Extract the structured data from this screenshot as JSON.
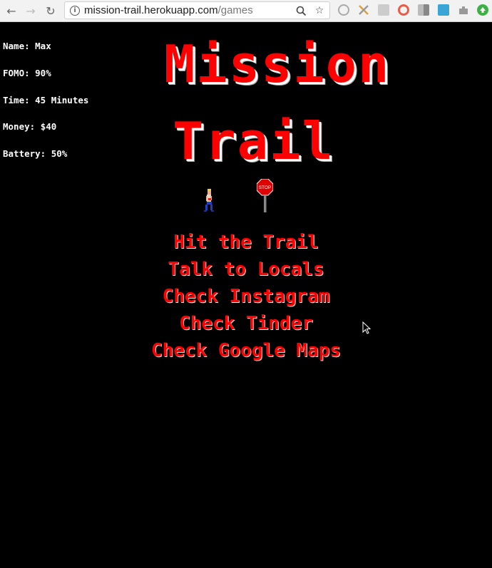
{
  "browser": {
    "url_host": "mission-trail.herokuapp.com",
    "url_path": "/games",
    "back_icon": "back-arrow-icon",
    "forward_icon": "forward-arrow-icon",
    "reload_icon": "reload-icon"
  },
  "stats": [
    {
      "label": "Name: ",
      "value": "Max"
    },
    {
      "label": "FOMO: ",
      "value": "90%"
    },
    {
      "label": "Time: ",
      "value": "45 Minutes"
    },
    {
      "label": "Money: ",
      "value": "$40"
    },
    {
      "label": "Battery: ",
      "value": "50%"
    }
  ],
  "title": {
    "line1": "Mission",
    "line2": "Trail"
  },
  "sign_text": "STOP",
  "menu": [
    "Hit the Trail",
    "Talk to Locals",
    "Check Instagram",
    "Check Tinder",
    "Check Google Maps"
  ],
  "colors": {
    "background": "#000000",
    "title": "#ff0000",
    "menu": "#ff0000",
    "stats": "#ffffff"
  }
}
